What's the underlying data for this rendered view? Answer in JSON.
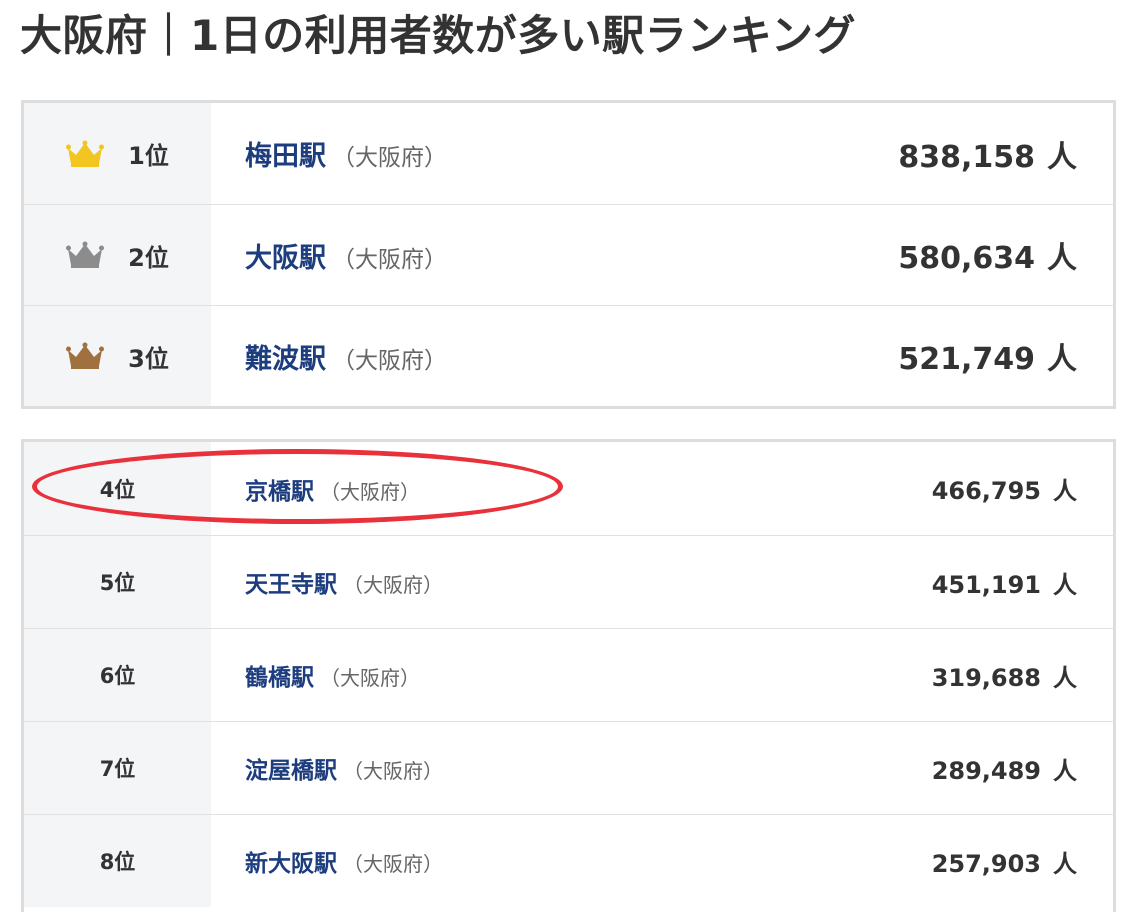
{
  "title": "大阪府｜1日の利用者数が多い駅ランキング",
  "top3": [
    {
      "rank": "1位",
      "crown": "gold-crown-icon",
      "crown_color": "#f2c620",
      "station": "梅田駅",
      "pref": "（大阪府）",
      "count": "838,158",
      "unit": "人"
    },
    {
      "rank": "2位",
      "crown": "silver-crown-icon",
      "crown_color": "#8c8c8c",
      "station": "大阪駅",
      "pref": "（大阪府）",
      "count": "580,634",
      "unit": "人"
    },
    {
      "rank": "3位",
      "crown": "bronze-crown-icon",
      "crown_color": "#a0703e",
      "station": "難波駅",
      "pref": "（大阪府）",
      "count": "521,749",
      "unit": "人"
    }
  ],
  "rest": [
    {
      "rank": "4位",
      "station": "京橋駅",
      "pref": "（大阪府）",
      "count": "466,795",
      "unit": "人"
    },
    {
      "rank": "5位",
      "station": "天王寺駅",
      "pref": "（大阪府）",
      "count": "451,191",
      "unit": "人"
    },
    {
      "rank": "6位",
      "station": "鶴橋駅",
      "pref": "（大阪府）",
      "count": "319,688",
      "unit": "人"
    },
    {
      "rank": "7位",
      "station": "淀屋橋駅",
      "pref": "（大阪府）",
      "count": "289,489",
      "unit": "人"
    },
    {
      "rank": "8位",
      "station": "新大阪駅",
      "pref": "（大阪府）",
      "count": "257,903",
      "unit": "人"
    }
  ],
  "highlight_color": "#e8313a"
}
